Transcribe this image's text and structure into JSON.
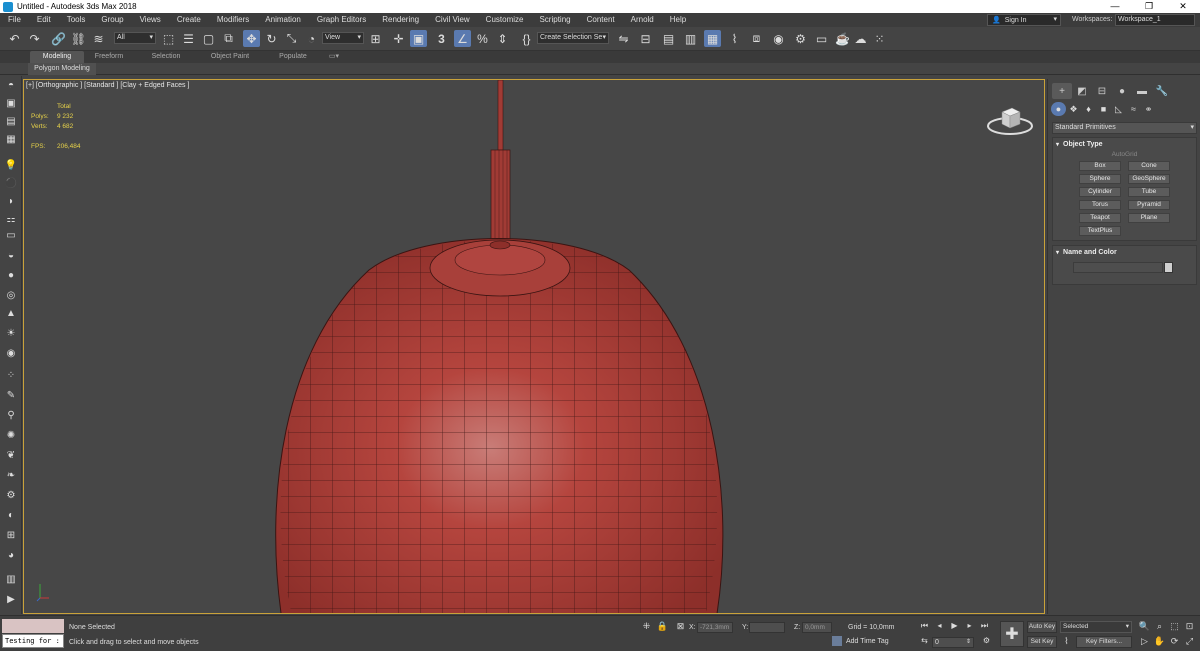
{
  "window": {
    "title": "Untitled - Autodesk 3ds Max 2018",
    "controls": [
      "—",
      "❐",
      "✕"
    ]
  },
  "menu": [
    "File",
    "Edit",
    "Tools",
    "Group",
    "Views",
    "Create",
    "Modifiers",
    "Animation",
    "Graph Editors",
    "Rendering",
    "Civil View",
    "Customize",
    "Scripting",
    "Content",
    "Arnold",
    "Help"
  ],
  "account": {
    "signin_label": "Sign In",
    "workspaces_label": "Workspaces:",
    "workspace_value": "Workspace_1"
  },
  "toolbar": {
    "filter_value": "All",
    "refcoord_value": "View",
    "selection_set_placeholder": "Create Selection Se",
    "snap_label": "3"
  },
  "ribbon": {
    "tabs": [
      "Modeling",
      "Freeform",
      "Selection",
      "Object Paint",
      "Populate"
    ],
    "active_tab": "Modeling",
    "panel_label": "Polygon Modeling"
  },
  "viewport": {
    "label": "[+] [Orthographic ] [Standard ] [Clay + Edged Faces ]",
    "stats_header": "Total",
    "polys_label": "Polys:",
    "polys_value": "9 232",
    "verts_label": "Verts:",
    "verts_value": "4 682",
    "fps_label": "FPS:",
    "fps_value": "206,484",
    "object_color": "#b5453e",
    "border_color": "#c9a23a"
  },
  "command_panel": {
    "category_dropdown": "Standard Primitives",
    "object_type_title": "Object Type",
    "autogrid_label": "AutoGrid",
    "primitives": [
      "Box",
      "Cone",
      "Sphere",
      "GeoSphere",
      "Cylinder",
      "Tube",
      "Torus",
      "Pyramid",
      "Teapot",
      "Plane",
      "TextPlus"
    ],
    "name_color_title": "Name and Color"
  },
  "status": {
    "script_input": "Testing for :",
    "selection_status": "None Selected",
    "prompt": "Click and drag to select and move objects",
    "x_label": "X:",
    "x_value": "-721,3mm",
    "y_label": "Y:",
    "y_value": "",
    "z_label": "Z:",
    "z_value": "0,0mm",
    "grid": "Grid = 10,0mm",
    "add_time_tag": "Add Time Tag",
    "frame_value": "0",
    "auto_key": "Auto Key",
    "set_key": "Set Key",
    "selected_dropdown": "Selected",
    "key_filters": "Key Filters..."
  }
}
